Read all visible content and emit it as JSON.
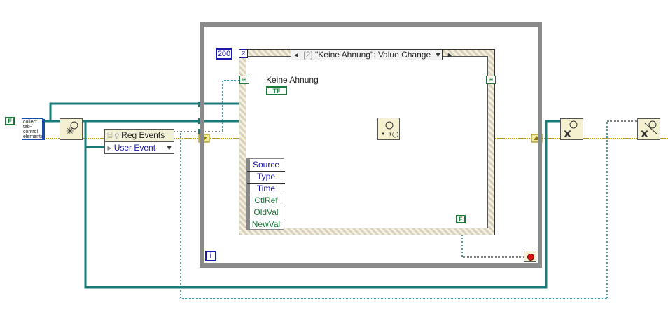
{
  "timeout": {
    "value": "200",
    "icon": "hourglass-icon"
  },
  "case_selector": {
    "index": "[2]",
    "label": "\"Keine Ahnung\": Value Change"
  },
  "control": {
    "label": "Keine Ahnung",
    "terminal": "TF"
  },
  "event_data": {
    "items": [
      "Source",
      "Type",
      "Time",
      "CtlRef",
      "OldVal",
      "NewVal"
    ]
  },
  "subvi": {
    "label": "collect tab-control elements"
  },
  "false_constant": "F",
  "loop_false": "F",
  "reg_events": {
    "title": "Reg Events",
    "item": "User Event"
  },
  "iteration_terminal": "i",
  "colors": {
    "ref_wire": "#1a7a7a",
    "error_wire": "#b8a300",
    "loop_frame": "#8a8a8a",
    "text_blue": "#1a1aa8",
    "text_green": "#1a7a3a"
  }
}
